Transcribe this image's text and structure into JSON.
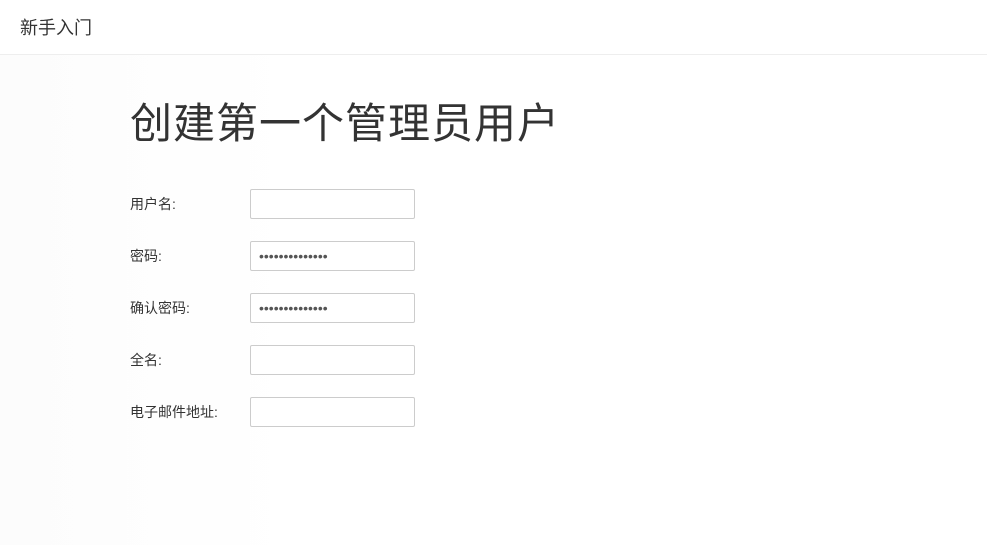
{
  "header": {
    "title": "新手入门"
  },
  "main": {
    "title": "创建第一个管理员用户"
  },
  "form": {
    "username": {
      "label": "用户名:",
      "value": ""
    },
    "password": {
      "label": "密码:",
      "value": "••••••••••••••"
    },
    "confirm_password": {
      "label": "确认密码:",
      "value": "••••••••••••••"
    },
    "fullname": {
      "label": "全名:",
      "value": ""
    },
    "email": {
      "label": "电子邮件地址:",
      "value": ""
    }
  }
}
